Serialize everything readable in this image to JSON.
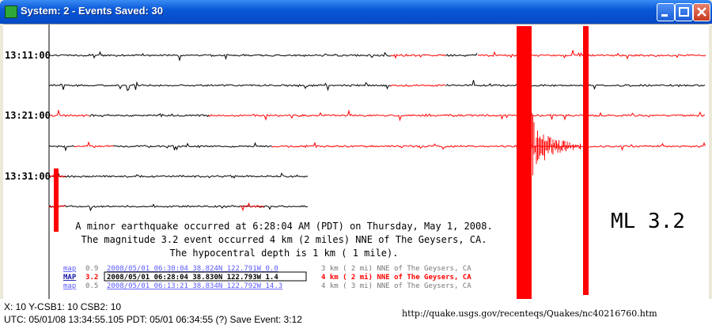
{
  "window": {
    "title": "System: 2 - Events Saved: 30"
  },
  "time_labels": [
    "13:11:00",
    "13:21:00",
    "13:31:00"
  ],
  "quake_text": {
    "line1": "A minor earthquake occurred at 6:28:04 AM (PDT) on Thursday, May 1, 2008.",
    "line2": "The magnitude 3.2 event occurred 4 km (2 miles) NNE of The Geysers, CA.",
    "line3": "The hypocentral depth is 1 km ( 1 mile)."
  },
  "magnitude_label": "ML 3.2",
  "events": [
    {
      "type": "map",
      "mag": "0.9",
      "datetime_loc": "2008/05/01 06:30:04 38.824N 122.791W  0.0",
      "distance": "3 km ( 2 mi) NNE of The Geysers, CA"
    },
    {
      "type": "MAP",
      "mag": "3.2",
      "datetime_loc": "2008/05/01 06:28:04 38.830N 122.793W  1.4",
      "distance": "4 km ( 2 mi) NNE of The Geysers, CA"
    },
    {
      "type": "map",
      "mag": "0.5",
      "datetime_loc": "2008/05/01 06:13:21 38.834N 122.792W 14.3",
      "distance": "4 km ( 3 mi) NNE of The Geysers, CA"
    }
  ],
  "status": {
    "line1": "X: 10  Y-CSB1: 10  CSB2: 10",
    "line2": "UTC: 05/01/08 13:34:55.105  PDT: 05/01 06:34:55 (?)  Save Event: 3:12",
    "url": "http://quake.usgs.gov/recenteqs/Quakes/nc40216760.htm"
  },
  "colors": {
    "trace_black": "#000000",
    "trace_red": "#ff0000",
    "link_blue": "#5a5aff",
    "highlight_red": "#ff0000"
  },
  "icons": [
    "app-seismograph-icon",
    "minimize-icon",
    "maximize-icon",
    "close-icon"
  ]
}
